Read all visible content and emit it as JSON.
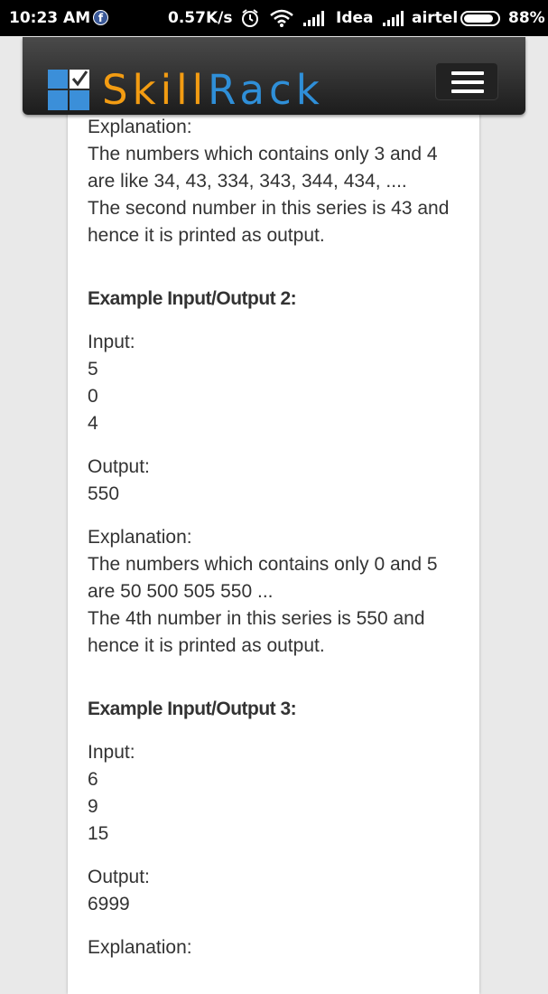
{
  "status_bar": {
    "time": "10:23 AM",
    "speed": "0.57K/s",
    "carrier1": "Idea",
    "carrier2": "airtel",
    "battery": "88%",
    "battery_level": 0.88,
    "icons": [
      "facebook-icon",
      "alarm-icon",
      "wifi-icon",
      "signal-icon",
      "signal-icon",
      "battery-icon"
    ]
  },
  "header": {
    "brand_part1": "Skill",
    "brand_part2": "Rack",
    "brand_colors": {
      "skill": "#f39c12",
      "rack": "#2f8fd8"
    },
    "menu_icon": "hamburger-menu-icon"
  },
  "content": {
    "explanation1_label": "Explanation:",
    "explanation1_lines": [
      "The numbers which contains only 3 and 4",
      "are like 34, 43, 334, 343, 344, 434, ....",
      "The second number in this series is 43 and",
      "hence it is printed as output."
    ],
    "example2": {
      "heading": "Example Input/Output 2:",
      "input_label": "Input:",
      "input_lines": [
        "5",
        "0",
        "4"
      ],
      "output_label": "Output:",
      "output_value": "550",
      "explanation_label": "Explanation:",
      "explanation_lines": [
        "The numbers which contains only 0 and 5",
        "are 50 500 505 550 ...",
        "The 4th number in this series is 550 and",
        "hence it is printed as output."
      ]
    },
    "example3": {
      "heading": "Example Input/Output 3:",
      "input_label": "Input:",
      "input_lines": [
        "6",
        "9",
        "15"
      ],
      "output_label": "Output:",
      "output_value": "6999",
      "explanation_label": "Explanation:"
    }
  }
}
